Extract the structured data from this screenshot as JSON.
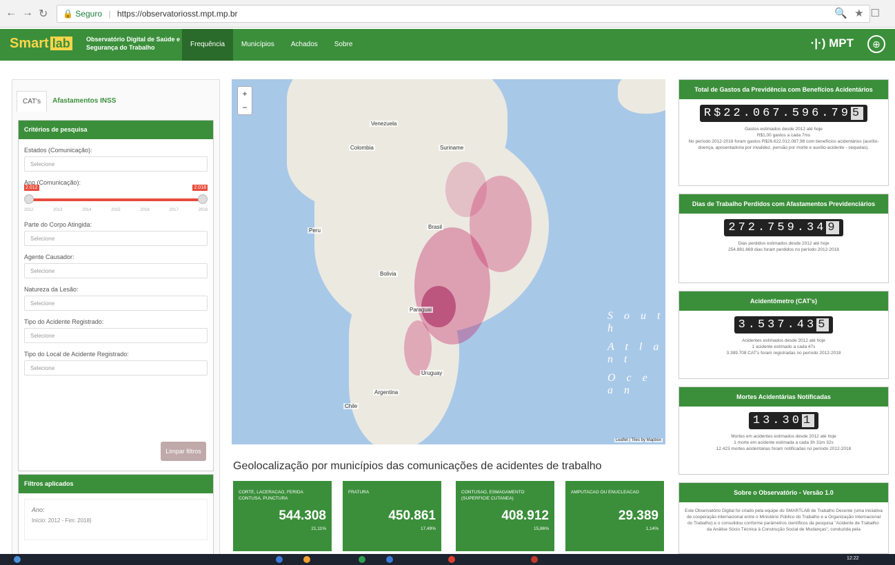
{
  "browser": {
    "secure_label": "Seguro",
    "url": "https://observatoriosst.mpt.mp.br"
  },
  "topbar": {
    "logo_text": "Smart",
    "logo_lab": "lab",
    "observatory": "Observatório Digital de Saúde e Segurança do Trabalho",
    "menu": [
      "Frequência",
      "Municípios",
      "Achados",
      "Sobre"
    ],
    "mpt_label": "MPT"
  },
  "left": {
    "tabs": [
      "CAT's",
      "Afastamentos INSS"
    ],
    "criteria_title": "Critérios de pesquisa",
    "filters": [
      {
        "label": "Estados (Comunicação):",
        "placeholder": "Selecione"
      },
      {
        "label": "Parte do Corpo Atingida:",
        "placeholder": "Selecione"
      },
      {
        "label": "Agente Causador:",
        "placeholder": "Selecione"
      },
      {
        "label": "Natureza da Lesão:",
        "placeholder": "Selecione"
      },
      {
        "label": "Tipo do Acidente Registrado:",
        "placeholder": "Selecione"
      },
      {
        "label": "Tipo do Local de Acidente Registrado:",
        "placeholder": "Selecione"
      }
    ],
    "year_label": "Ano (Comunicação):",
    "year_from": "2.012",
    "year_to": "2.018",
    "year_ticks": [
      "2012",
      "2013",
      "2014",
      "2015",
      "2016",
      "2017",
      "2018"
    ],
    "clear_button": "Limpar filtros",
    "applied_title": "Filtros aplicados",
    "applied_item_title": "Ano:",
    "applied_item_value": "Início: 2012 - Fim: 2018)"
  },
  "map": {
    "ocean_text": [
      "S o u t h",
      "A t l a n t",
      "O c e a n"
    ],
    "labels": [
      "Venezuela",
      "Colombia",
      "Brasil",
      "Peru",
      "Bolivia",
      "Paraguai",
      "Argentina",
      "Chile",
      "Uruguay",
      "Suriname"
    ],
    "attribution": "Leaflet | Tiles by Mapbox"
  },
  "geo_title": "Geolocalização por municípios das comunicações de acidentes de trabalho",
  "cards": [
    {
      "label": "CORTE, LACERACAO, FERIDA CONTUSA, PUNCTURA",
      "value": "544.308",
      "pct": "21,11%"
    },
    {
      "label": "FRATURA",
      "value": "450.861",
      "pct": "17,49%"
    },
    {
      "label": "CONTUSAO, ESMAGAMENTO (SUPERFICIE CUTANEA)",
      "value": "408.912",
      "pct": "15,86%"
    },
    {
      "label": "AMPUTACAO OU ENUCLEACAO",
      "value": "29.389",
      "pct": "1,14%"
    }
  ],
  "right": [
    {
      "title": "Total de Gastos da Previdência com Benefícios Acidentários",
      "prefix": "R$",
      "counter": "22.067.596.79",
      "last": "5",
      "text": "Gastos estimados desde 2012 até hoje\nR$1,00 gastos a cada 7ms\nNo período 2012-2018 foram gastos R$26.622.012.087,98 com benefícios acidentários (auxílio-doença, aposentadoria por invalidez, pensão por morte e auxílio-acidente - sequelas)."
    },
    {
      "title": "Dias de Trabalho Perdidos com Afastamentos Previdenciários",
      "prefix": "",
      "counter": "272.759.34",
      "last": "9",
      "text": "Dias perdidos estimados desde 2012 até hoje\n254.881.669 dias foram perdidos no período 2012-2018"
    },
    {
      "title": "Acidentômetro (CAT's)",
      "prefix": "",
      "counter": "3.537.43",
      "last": "5",
      "text": "Acidentes estimados desde 2012 até hoje\n1 acidente estimado a cada 47s\n3.389.708 CAT's foram registradas no período 2012-2018"
    },
    {
      "title": "Mortes Acidentárias Notificadas",
      "prefix": "",
      "counter": "13.30",
      "last": "1",
      "text": "Mortes em acidentes estimados desde 2012 até hoje\n1 morte em acidente estimada a cada 3h 31m 32s\n12.423 mortes acidentárias foram notificadas no período 2012-2018"
    },
    {
      "title": "Sobre o Observatório - Versão 1.0",
      "prefix": "",
      "counter": "",
      "last": "",
      "text": "Este Observatório Digital foi criado pela equipe do SMARTLAB de Trabalho Decente (uma iniciativa de cooperação internacional entre o Ministério Público do Trabalho e a Organização Internacional do Trabalho) e o consolidou conforme parâmetros científicos da pesquisa \"Acidente de Trabalho: da Análise Sócio Técnica à Construção Social de Mudanças\", conduzida pela"
    }
  ],
  "taskbar_time": "12:22"
}
